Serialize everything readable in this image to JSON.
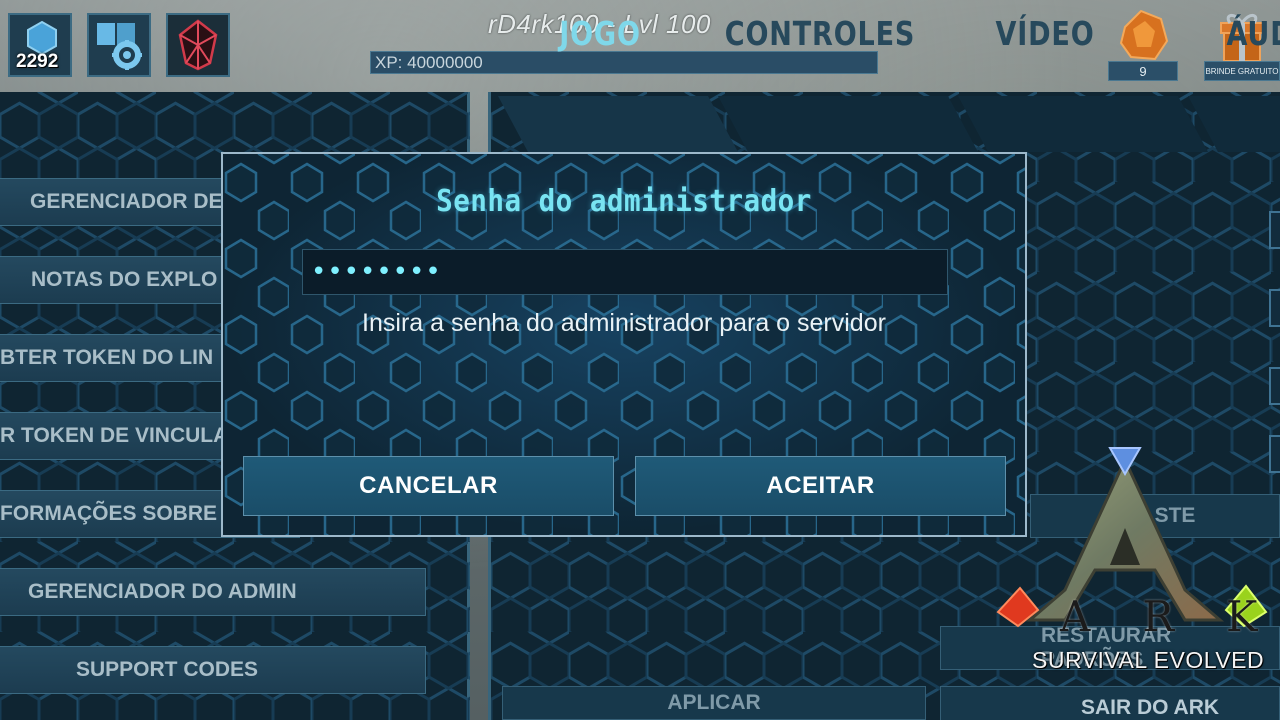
{
  "hud": {
    "coins": "2292",
    "player_name": "rD4rk100 - Lvl 100",
    "xp_label": "XP: 40000000",
    "reward_count": "9",
    "free_gift_label": "BRINDE GRATUITO"
  },
  "left_menu": {
    "items": [
      "GERENCIADOR DE",
      "NOTAS DO EXPLO",
      "BTER TOKEN DO LIN",
      "R TOKEN DE VINCULA",
      "FORMAÇÕES SOBRE",
      "GERENCIADOR DO ADMIN",
      "SUPPORT CODES"
    ]
  },
  "tabs": [
    "JOGO",
    "CONTROLES",
    "VÍDEO",
    "ÁUD"
  ],
  "right_buttons": {
    "partial": "STE",
    "restore": "RESTAURAR PADRÕES",
    "exit": "SAIR DO ARK",
    "apply": "APLICAR"
  },
  "dialog": {
    "title": "Senha do administrador",
    "password_value": "••••••••",
    "message": "Insira a senha do administrador para o servidor",
    "cancel_label": "CANCELAR",
    "accept_label": "ACEITAR"
  },
  "logo": {
    "letters": "ARK",
    "subtitle": "SURVIVAL EVOLVED"
  },
  "colors": {
    "dialog_title": "#79e4f2",
    "tab_active": "#7fd8ea",
    "tab_inactive": "#27495c",
    "panel_bg": "#0f2532"
  }
}
